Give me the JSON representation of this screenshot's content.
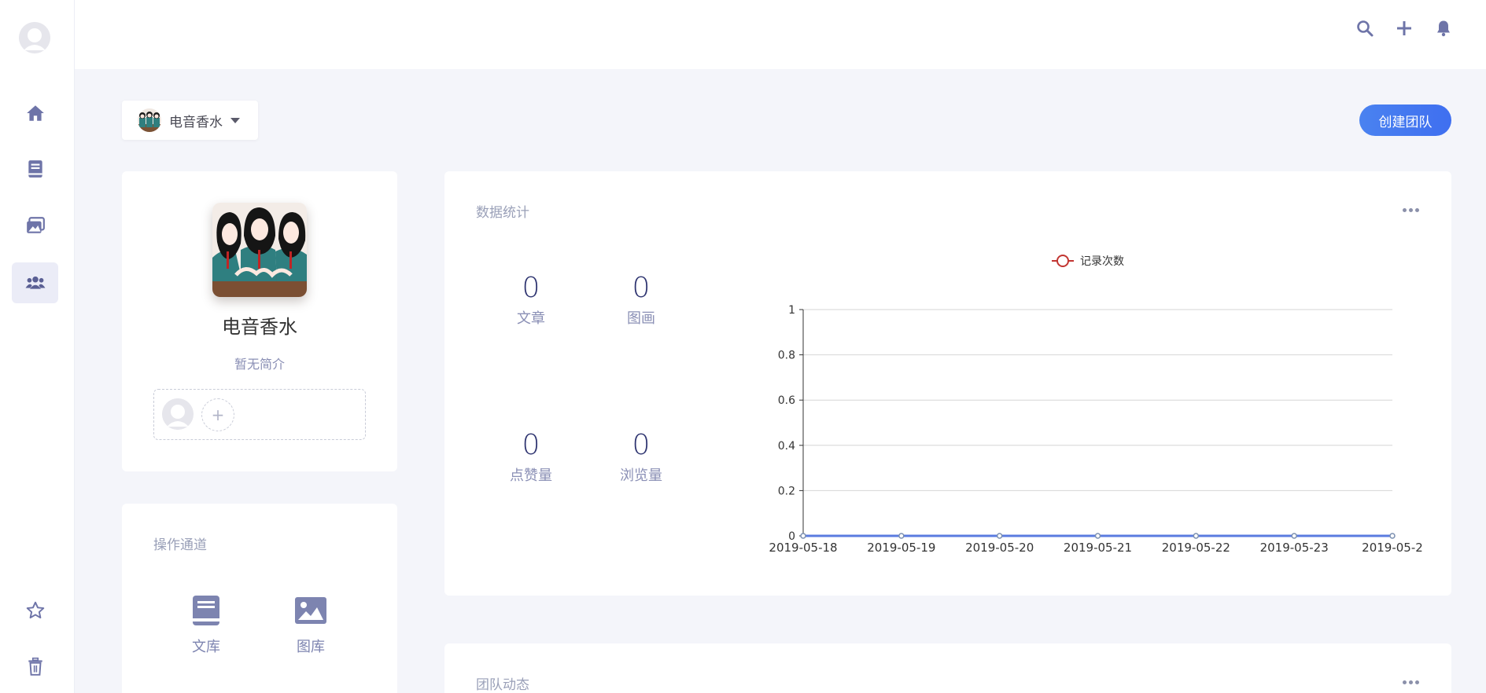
{
  "header": {
    "icons": [
      "search-icon",
      "plus-icon",
      "bell-icon"
    ]
  },
  "sidebar": {
    "items": [
      {
        "icon": "home-icon",
        "active": false
      },
      {
        "icon": "book-icon",
        "active": false
      },
      {
        "icon": "images-icon",
        "active": false
      },
      {
        "icon": "team-icon",
        "active": true
      },
      {
        "icon": "star-icon",
        "active": false
      },
      {
        "icon": "trash-icon",
        "active": false
      }
    ]
  },
  "team_selector": {
    "name": "电音香水"
  },
  "create_button": {
    "label": "创建团队"
  },
  "profile": {
    "name": "电音香水",
    "description": "暂无简介",
    "add_member": "+"
  },
  "operations": {
    "title": "操作通道",
    "items": [
      {
        "label": "文库",
        "icon": "book-icon"
      },
      {
        "label": "图库",
        "icon": "image-icon"
      }
    ]
  },
  "stats": {
    "title": "数据统计",
    "items": [
      {
        "value": "0",
        "label": "文章"
      },
      {
        "value": "0",
        "label": "图画"
      },
      {
        "value": "0",
        "label": "点赞量"
      },
      {
        "value": "0",
        "label": "浏览量"
      }
    ]
  },
  "activity": {
    "title": "团队动态"
  },
  "colors": {
    "accent": "#4a7ef0",
    "line": "#5a7be0",
    "legend": "#c23531",
    "muted": "#8a8fb5"
  },
  "chart_data": {
    "type": "line",
    "legend": "记录次数",
    "legend_position": "top-center",
    "categories": [
      "2019-05-18",
      "2019-05-19",
      "2019-05-20",
      "2019-05-21",
      "2019-05-22",
      "2019-05-23",
      "2019-05-2"
    ],
    "series": [
      {
        "name": "记录次数",
        "values": [
          0,
          0,
          0,
          0,
          0,
          0,
          0
        ]
      }
    ],
    "yticks": [
      "0",
      "0.2",
      "0.4",
      "0.6",
      "0.8",
      "1"
    ],
    "ylim": [
      0,
      1
    ],
    "grid": true
  }
}
